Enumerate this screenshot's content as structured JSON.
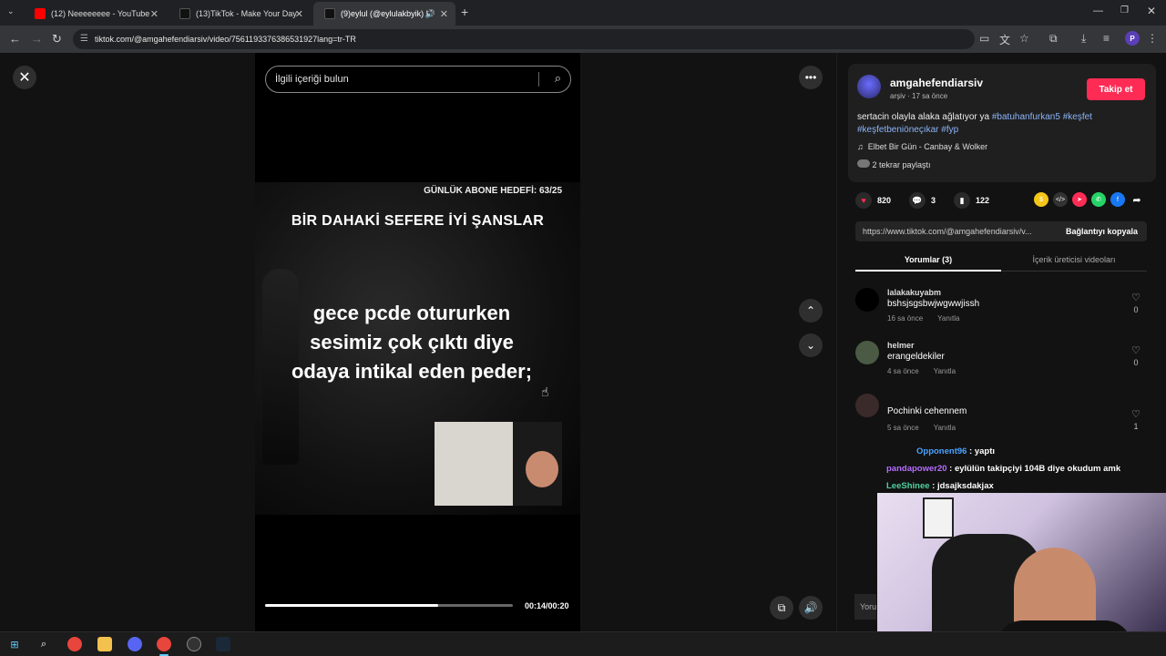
{
  "browser": {
    "tabs": [
      {
        "title": "(12) Neeeeeeee - YouTube",
        "active": false
      },
      {
        "title": "(13)TikTok - Make Your Day",
        "active": false
      },
      {
        "title": "(9)eylul (@eylulakbyik) | Tik",
        "active": true
      }
    ],
    "url": "tiktok.com/@amgahefendiarsiv/video/7561193376386531927lang=tr-TR",
    "profile_initial": "P"
  },
  "video": {
    "search_placeholder": "İlgili içeriği bulun",
    "goal_text": "GÜNLÜK ABONE HEDEFİ: 63/25",
    "luck_text": "BİR DAHAKİ SEFERE İYİ ŞANSLAR",
    "caption_lines": [
      "gece pcde otururken",
      "sesimiz çok çıktı diye",
      "odaya intikal eden peder;"
    ],
    "time": "00:14/00:20",
    "progress": 0.7
  },
  "panel": {
    "username": "amgahefendiarsiv",
    "subline": "arşiv · 17 sa önce",
    "follow_label": "Takip et",
    "desc_text": "sertacin olayla alaka ağlatıyor ya ",
    "desc_tags": [
      "#batuhanfurkan5",
      "#keşfet",
      "#keşfetbeniöneçıkar",
      "#fyp"
    ],
    "music": "Elbet Bir Gün - Canbay & Wolker",
    "repost": "2 tekrar paylaştı",
    "likes": "820",
    "comments": "3",
    "saves": "122",
    "link": "https://www.tiktok.com/@amgahefendiarsiv/v...",
    "copy_label": "Bağlantıyı kopyala",
    "tab_comments": "Yorumlar (3)",
    "tab_creator": "İçerik üreticisi videoları",
    "comments_list": [
      {
        "user": "lalakakuyabm",
        "text": "bshsjsgsbwjwgwwjissh",
        "time": "16 sa önce",
        "reply": "Yanıtla",
        "likes": "0"
      },
      {
        "user": "helmer",
        "text": "erangeldekiler",
        "time": "4 sa önce",
        "reply": "Yanıtla",
        "likes": "0"
      },
      {
        "user": "",
        "text": "Pochinki cehennem",
        "time": "5 sa önce",
        "reply": "Yanıtla",
        "likes": "1"
      }
    ],
    "comment_input_placeholder": "Yoru"
  },
  "chat": [
    {
      "user": "Opponent96",
      "msg": " : yaptı"
    },
    {
      "user": "pandapower20",
      "msg": " : eylülün takipçiyi 104B diye okudum amk"
    },
    {
      "user": "LeeShinee",
      "msg": " : jdsajksdakjax"
    }
  ]
}
